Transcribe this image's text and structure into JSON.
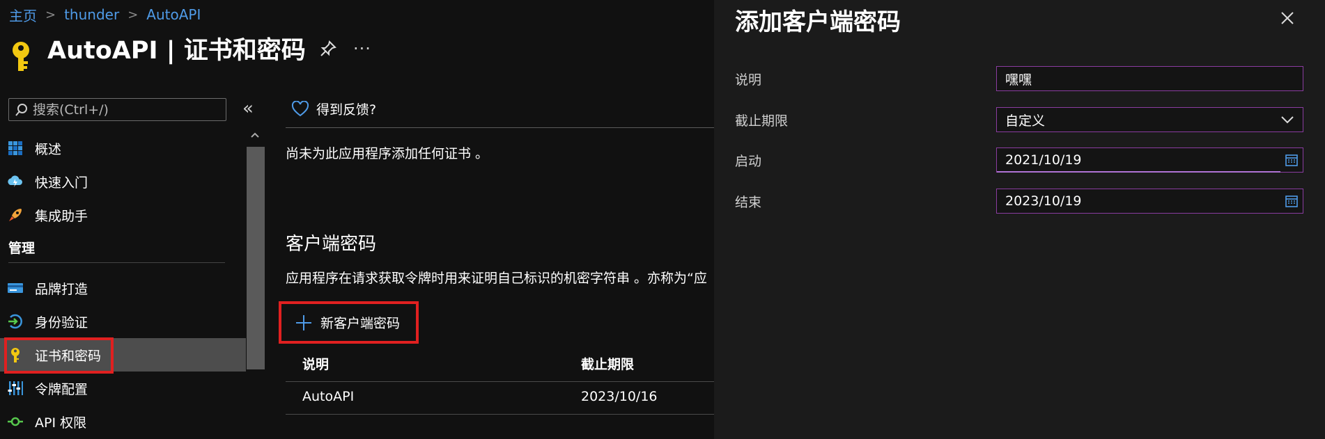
{
  "breadcrumb": {
    "items": [
      "主页",
      "thunder",
      "AutoAPI"
    ],
    "separator": ">"
  },
  "header": {
    "title": "AutoAPI | 证书和密码",
    "more": "···",
    "icon": "key-icon"
  },
  "sidebar": {
    "search_placeholder": "搜索(Ctrl+/)",
    "collapse": "«",
    "items": [
      {
        "label": "概述",
        "icon": "overview-grid-icon"
      },
      {
        "label": "快速入门",
        "icon": "cloud-lightning-icon"
      },
      {
        "label": "集成助手",
        "icon": "rocket-icon"
      }
    ],
    "section_label": "管理",
    "manage_items": [
      {
        "label": "品牌打造",
        "icon": "brand-card-icon"
      },
      {
        "label": "身份验证",
        "icon": "auth-arrow-icon"
      },
      {
        "label": "证书和密码",
        "icon": "key-icon",
        "selected": true
      },
      {
        "label": "令牌配置",
        "icon": "token-sliders-icon"
      },
      {
        "label": "API 权限",
        "icon": "api-permission-icon"
      }
    ]
  },
  "main": {
    "feedback_label": "得到反馈?",
    "no_certificates_text": "尚未为此应用程序添加任何证书 。",
    "client_secrets_heading": "客户端密码",
    "client_secrets_desc": "应用程序在请求获取令牌时用来证明自己标识的机密字符串 。亦称为“应",
    "new_secret_label": "新客户端密码",
    "table": {
      "headers": [
        "说明",
        "截止期限"
      ],
      "rows": [
        [
          "AutoAPI",
          "2023/10/16"
        ]
      ]
    }
  },
  "panel": {
    "title": "添加客户端密码",
    "fields": {
      "description": {
        "label": "说明",
        "value": "嘿嘿"
      },
      "expires": {
        "label": "截止期限",
        "value": "自定义"
      },
      "start": {
        "label": "启动",
        "value": "2021/10/19"
      },
      "end": {
        "label": "结束",
        "value": "2023/10/19"
      }
    }
  },
  "colors": {
    "background": "#111111",
    "panel_background": "#1b1b1b",
    "link": "#4f9be8",
    "highlight_box": "#e02020",
    "field_border": "#8a3ca0",
    "selected_nav": "#4d4d4d"
  }
}
